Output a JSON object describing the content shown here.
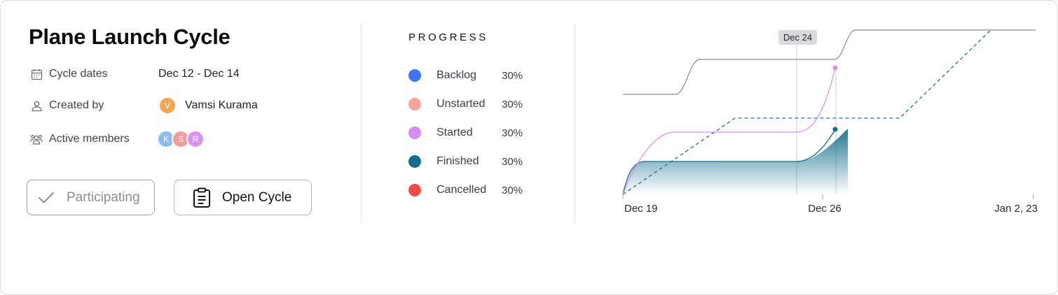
{
  "cycle": {
    "title": "Plane Launch Cycle",
    "dates_label": "Cycle dates",
    "dates_value": "Dec 12 - Dec 14",
    "created_by_label": "Created by",
    "creator": {
      "name": "Vamsi Kurama",
      "initial": "V",
      "color": "#f0a653"
    },
    "members_label": "Active members",
    "members": [
      {
        "initial": "K",
        "color": "#8bbcf5"
      },
      {
        "initial": "S",
        "color": "#f59a98"
      },
      {
        "initial": "R",
        "color": "#d792f0"
      }
    ]
  },
  "actions": {
    "participating_label": "Participating",
    "open_cycle_label": "Open Cycle"
  },
  "progress": {
    "heading": "PROGRESS",
    "items": [
      {
        "label": "Backlog",
        "percent": "30%",
        "color": "#3f76f8"
      },
      {
        "label": "Unstarted",
        "percent": "30%",
        "color": "#f9a3a1"
      },
      {
        "label": "Started",
        "percent": "30%",
        "color": "#d98af4"
      },
      {
        "label": "Finished",
        "percent": "30%",
        "color": "#136f8c"
      },
      {
        "label": "Cancelled",
        "percent": "30%",
        "color": "#f24b4e"
      }
    ]
  },
  "chart_data": {
    "type": "line",
    "x_ticks": [
      "Dec 19",
      "Dec 26",
      "Jan 2, 23"
    ],
    "tooltip": "Dec 24",
    "colors": {
      "total": "#8c8e91",
      "ideal": "#1f6f8f",
      "started": "#d98af4",
      "finished": "#136f8c",
      "tooltip_bg": "#d8dadd"
    }
  }
}
